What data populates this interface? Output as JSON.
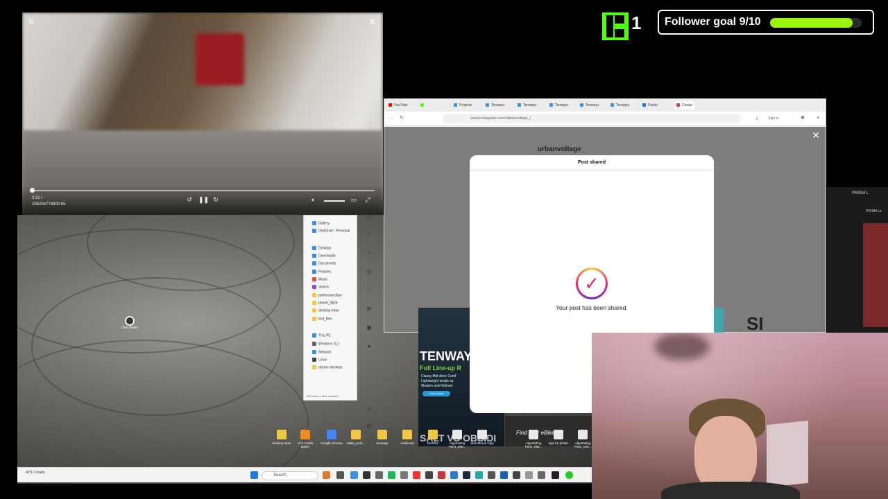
{
  "video_player": {
    "time_current": "3:31 /",
    "time_total": "256204778800:55"
  },
  "kick": {
    "count": "1"
  },
  "follower_goal": {
    "label": "Follower goal 9/10",
    "progress": 0.9,
    "fill_color": "#9bf40d"
  },
  "browser": {
    "tabs": [
      "YouTube",
      "",
      "Projects",
      "Tenways",
      "Tenways",
      "Tenways",
      "Tenways",
      "Tenways",
      "Faceb",
      "Create"
    ],
    "url": "www.instagram.com/urbanvoltage_/",
    "sign_in": "Sign in"
  },
  "instagram": {
    "username": "urbanvoltage_",
    "modal_title": "Post shared",
    "modal_message": "Your post has been shared."
  },
  "explorer": {
    "items": [
      "Gallery",
      "OneDrive - Personal",
      "Desktop",
      "Downloads",
      "Documents",
      "Pictures",
      "Music",
      "Videos",
      "pythonsandbox",
      "phone_SB/5",
      "desktop lmao",
      "tool_files",
      "This PC",
      "Windows (C:)",
      "Network",
      "Linux",
      "docker-desktop"
    ],
    "status": "509 items   1 item selected"
  },
  "ad": {
    "brand": "TENWAY",
    "subtitle": "Full Line-up R",
    "bullets": [
      "Classy Mid-drive Comf",
      "Lightweight single sp",
      "Modern and Refined"
    ],
    "button": "Learn More",
    "bottom_text": "SALT VS OBSIDI",
    "find_text": "Find your eBike"
  },
  "desktop_icons": [
    {
      "label": "desktop lmao",
      "color": "#f2c744"
    },
    {
      "label": "VLC media player",
      "color": "#f28a1e"
    },
    {
      "label": "Google Chrome",
      "color": "#4285f4"
    },
    {
      "label": "ebike_prod...",
      "color": "#f2c744"
    },
    {
      "label": "tenways",
      "color": "#f2c744"
    },
    {
      "label": "makeviral",
      "color": "#f2c744"
    },
    {
      "label": "beckhre",
      "color": "#f2c744"
    },
    {
      "label": "Algotrading Part1_Mat...",
      "color": "#e8e8e8"
    },
    {
      "label": "sketchbook copy",
      "color": "#e8e8e8"
    },
    {
      "label": "Algotrading Part1_Mat...",
      "color": "#e8e8e8"
    },
    {
      "label": "sigs for plotter",
      "color": "#e8e8e8"
    },
    {
      "label": "Algotrading Part1_Mat...",
      "color": "#e8e8e8"
    }
  ],
  "obs_label": "OBS Studio",
  "taskbar": {
    "weather": "49°F Cloudy",
    "search_placeholder": "Search"
  },
  "right_window": {
    "title": "PRISM L",
    "subtitle": "PRISM Le"
  },
  "si_text": "SI"
}
